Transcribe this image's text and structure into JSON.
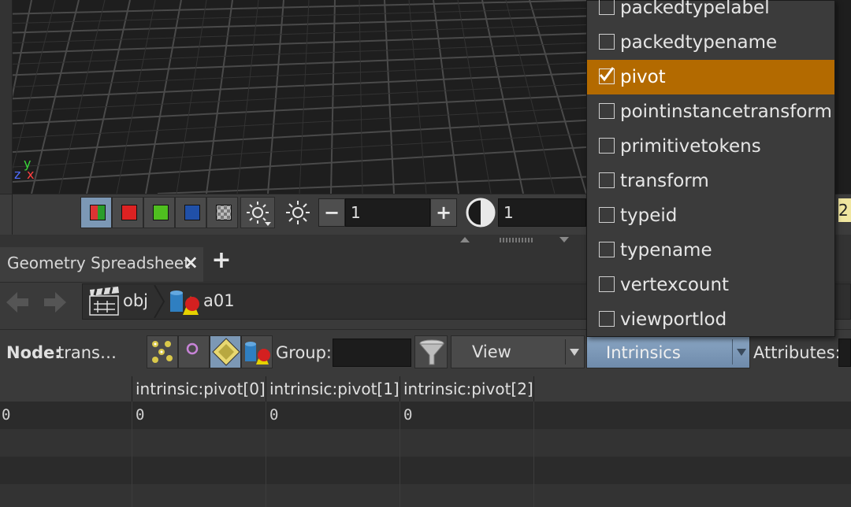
{
  "viewport": {
    "axis_labels": {
      "x": "x",
      "y": "y",
      "z": "z"
    }
  },
  "display_toolbar": {
    "frame_field_1": "1",
    "frame_field_2": "1",
    "minus_label": "−",
    "plus_label": "+"
  },
  "pane_tab": {
    "label": "Geometry Spreadsheet",
    "close_label": "×",
    "add_label": "+"
  },
  "path": {
    "root": "obj",
    "node": "a01"
  },
  "node_bar": {
    "node_label": "Node:",
    "node_value": "trans…",
    "group_label": "Group:",
    "group_value": "",
    "view_label": "View",
    "intrinsics_label": "Intrinsics",
    "attributes_label": "Attributes:",
    "edge_value": "2"
  },
  "spreadsheet": {
    "columns": [
      "intrinsic:pivot[0]",
      "intrinsic:pivot[1]",
      "intrinsic:pivot[2]"
    ],
    "rows": [
      {
        "index": "0",
        "values": [
          "0",
          "0",
          "0"
        ]
      }
    ]
  },
  "intrinsics_menu": {
    "items": [
      {
        "label": "packedtypelabel",
        "checked": false
      },
      {
        "label": "packedtypename",
        "checked": false
      },
      {
        "label": "pivot",
        "checked": true
      },
      {
        "label": "pointinstancetransform",
        "checked": false
      },
      {
        "label": "primitivetokens",
        "checked": false
      },
      {
        "label": "transform",
        "checked": false
      },
      {
        "label": "typeid",
        "checked": false
      },
      {
        "label": "typename",
        "checked": false
      },
      {
        "label": "vertexcount",
        "checked": false
      },
      {
        "label": "viewportlod",
        "checked": false
      }
    ]
  },
  "colors": {
    "selection": "#b36a00",
    "active_button": "#7c98b5"
  }
}
